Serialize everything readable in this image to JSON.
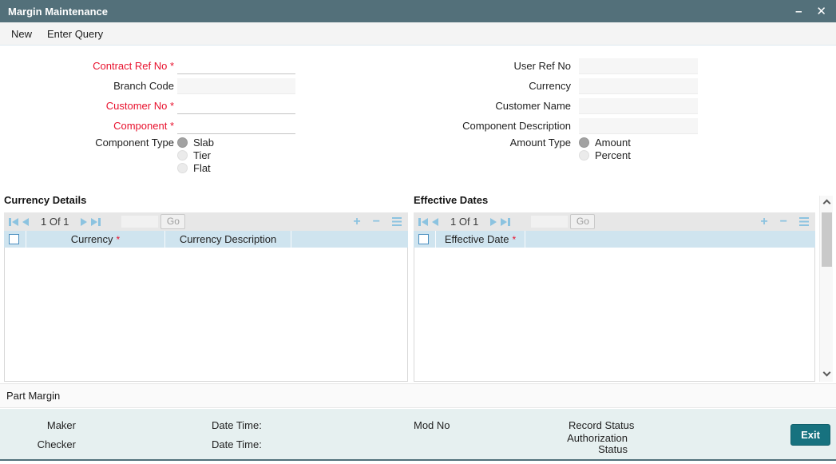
{
  "colors": {
    "titlebar": "#53707a",
    "accent_blue": "#8cc3e0",
    "exit_button": "#17727f",
    "required_red": "#e8112d",
    "table_header_bg": "#cfe4ef",
    "footer_bg": "#e6f0f0"
  },
  "window": {
    "title": "Margin Maintenance",
    "minimize_glyph": "–",
    "close_glyph": "✕"
  },
  "menu": {
    "new": "New",
    "enter_query": "Enter Query"
  },
  "form": {
    "required_marker": "*",
    "contract_ref_no": "Contract Ref No",
    "branch_code": "Branch Code",
    "customer_no": "Customer No",
    "component": "Component",
    "component_type": "Component Type",
    "component_type_options": [
      "Slab",
      "Tier",
      "Flat"
    ],
    "component_type_selected": "Slab",
    "user_ref_no": "User Ref No",
    "currency": "Currency",
    "customer_name": "Customer Name",
    "component_description": "Component Description",
    "amount_type": "Amount Type",
    "amount_type_options": [
      "Amount",
      "Percent"
    ],
    "amount_type_selected": "Amount",
    "field_values": {
      "contract_ref_no": "",
      "branch_code": "",
      "customer_no": "",
      "component": "",
      "user_ref_no": "",
      "currency": "",
      "customer_name": "",
      "component_description": ""
    }
  },
  "currency_details": {
    "title": "Currency Details",
    "pager": {
      "page_text": "1 Of 1",
      "go": "Go"
    },
    "columns": {
      "currency": "Currency",
      "currency_description": "Currency Description"
    }
  },
  "effective_dates": {
    "title": "Effective Dates",
    "pager": {
      "page_text": "1 Of 1",
      "go": "Go"
    },
    "columns": {
      "effective_date": "Effective Date"
    }
  },
  "part_margin": {
    "label": "Part Margin"
  },
  "footer": {
    "maker": "Maker",
    "checker": "Checker",
    "maker_date_time": "Date Time:",
    "checker_date_time": "Date Time:",
    "mod_no": "Mod No",
    "record_status": "Record Status",
    "authorization_status": "Authorization Status",
    "exit": "Exit"
  }
}
